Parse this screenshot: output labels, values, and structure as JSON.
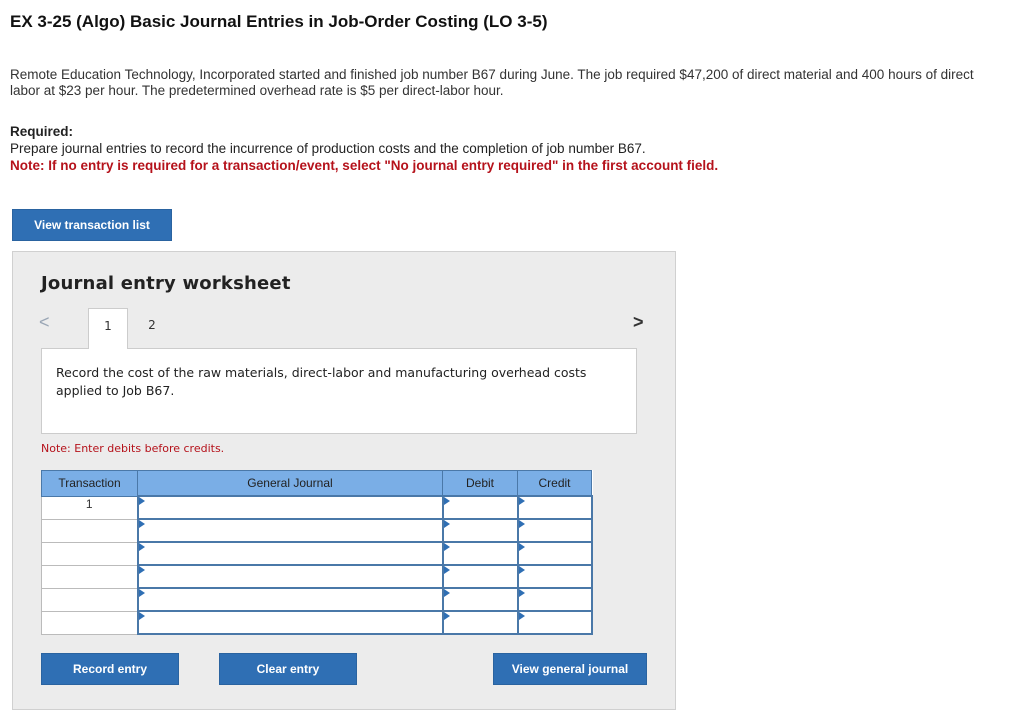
{
  "title": "EX 3-25 (Algo) Basic Journal Entries in Job-Order Costing (LO 3-5)",
  "intro": "Remote Education Technology, Incorporated started and finished job number B67 during June. The job required $47,200 of direct material and 400 hours of direct labor at $23 per hour. The predetermined overhead rate is $5 per direct-labor hour.",
  "required": {
    "heading": "Required:",
    "instruction": "Prepare journal entries to record the incurrence of production costs and the completion of job number B67.",
    "note": "Note: If no entry is required for a transaction/event, select \"No journal entry required\" in the first account field."
  },
  "buttons": {
    "view_transaction_list": "View transaction list",
    "record_entry": "Record entry",
    "clear_entry": "Clear entry",
    "view_general_journal": "View general journal"
  },
  "worksheet": {
    "title": "Journal entry worksheet",
    "nav_prev": "<",
    "nav_next": ">",
    "tabs": [
      "1",
      "2"
    ],
    "description": "Record the cost of the raw materials, direct-labor and manufacturing overhead costs applied to Job B67.",
    "note": "Note: Enter debits before credits."
  },
  "table": {
    "headers": [
      "Transaction",
      "General Journal",
      "Debit",
      "Credit"
    ],
    "rows": [
      {
        "transaction": "1"
      },
      {
        "transaction": ""
      },
      {
        "transaction": ""
      },
      {
        "transaction": ""
      },
      {
        "transaction": ""
      },
      {
        "transaction": ""
      }
    ]
  }
}
